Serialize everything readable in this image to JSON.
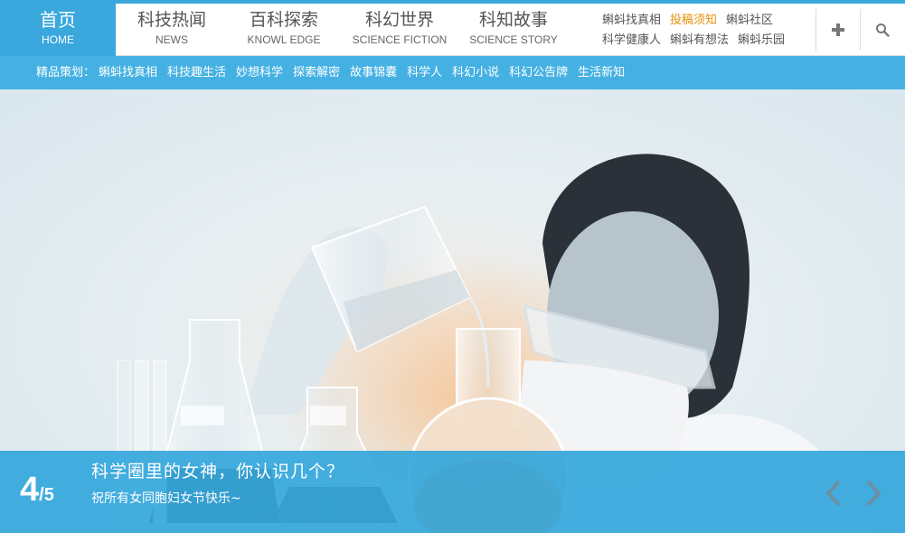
{
  "nav": {
    "home": {
      "cn": "首页",
      "en": "HOME"
    },
    "items": [
      {
        "cn": "科技热闻",
        "en": "NEWS"
      },
      {
        "cn": "百科探索",
        "en": "KNOWL EDGE"
      },
      {
        "cn": "科幻世界",
        "en": "SCIENCE FICTION"
      },
      {
        "cn": "科知故事",
        "en": "SCIENCE STORY"
      }
    ]
  },
  "quick_links": {
    "row1": [
      "蝌蚪找真相",
      "投稿须知",
      "蝌蚪社区"
    ],
    "row2": [
      "科学健康人",
      "蝌蚪有想法",
      "蝌蚪乐园"
    ]
  },
  "tools": {
    "add_icon": "plus-icon",
    "search_icon": "search-icon"
  },
  "subnav": {
    "label": "精品策划：",
    "items": [
      "蝌蚪找真相",
      "科技趣生活",
      "妙想科学",
      "探索解密",
      "故事锦囊",
      "科学人",
      "科幻小说",
      "科幻公告牌",
      "生活新知"
    ]
  },
  "slider": {
    "current": "4",
    "total": "/5",
    "title": "科学圈里的女神，你认识几个？",
    "subtitle": "祝所有女同胞妇女节快乐~"
  },
  "colors": {
    "primary": "#3aa8dd",
    "subnav": "#45b1e3",
    "highlight": "#e8900c"
  }
}
